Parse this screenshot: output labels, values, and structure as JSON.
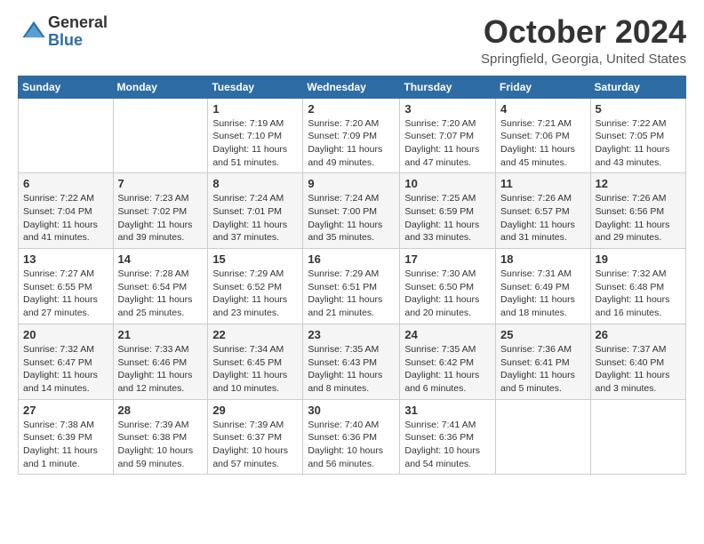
{
  "header": {
    "logo_general": "General",
    "logo_blue": "Blue",
    "month_title": "October 2024",
    "location": "Springfield, Georgia, United States"
  },
  "days_of_week": [
    "Sunday",
    "Monday",
    "Tuesday",
    "Wednesday",
    "Thursday",
    "Friday",
    "Saturday"
  ],
  "weeks": [
    [
      {
        "day": "",
        "info": ""
      },
      {
        "day": "",
        "info": ""
      },
      {
        "day": "1",
        "info": "Sunrise: 7:19 AM\nSunset: 7:10 PM\nDaylight: 11 hours and 51 minutes."
      },
      {
        "day": "2",
        "info": "Sunrise: 7:20 AM\nSunset: 7:09 PM\nDaylight: 11 hours and 49 minutes."
      },
      {
        "day": "3",
        "info": "Sunrise: 7:20 AM\nSunset: 7:07 PM\nDaylight: 11 hours and 47 minutes."
      },
      {
        "day": "4",
        "info": "Sunrise: 7:21 AM\nSunset: 7:06 PM\nDaylight: 11 hours and 45 minutes."
      },
      {
        "day": "5",
        "info": "Sunrise: 7:22 AM\nSunset: 7:05 PM\nDaylight: 11 hours and 43 minutes."
      }
    ],
    [
      {
        "day": "6",
        "info": "Sunrise: 7:22 AM\nSunset: 7:04 PM\nDaylight: 11 hours and 41 minutes."
      },
      {
        "day": "7",
        "info": "Sunrise: 7:23 AM\nSunset: 7:02 PM\nDaylight: 11 hours and 39 minutes."
      },
      {
        "day": "8",
        "info": "Sunrise: 7:24 AM\nSunset: 7:01 PM\nDaylight: 11 hours and 37 minutes."
      },
      {
        "day": "9",
        "info": "Sunrise: 7:24 AM\nSunset: 7:00 PM\nDaylight: 11 hours and 35 minutes."
      },
      {
        "day": "10",
        "info": "Sunrise: 7:25 AM\nSunset: 6:59 PM\nDaylight: 11 hours and 33 minutes."
      },
      {
        "day": "11",
        "info": "Sunrise: 7:26 AM\nSunset: 6:57 PM\nDaylight: 11 hours and 31 minutes."
      },
      {
        "day": "12",
        "info": "Sunrise: 7:26 AM\nSunset: 6:56 PM\nDaylight: 11 hours and 29 minutes."
      }
    ],
    [
      {
        "day": "13",
        "info": "Sunrise: 7:27 AM\nSunset: 6:55 PM\nDaylight: 11 hours and 27 minutes."
      },
      {
        "day": "14",
        "info": "Sunrise: 7:28 AM\nSunset: 6:54 PM\nDaylight: 11 hours and 25 minutes."
      },
      {
        "day": "15",
        "info": "Sunrise: 7:29 AM\nSunset: 6:52 PM\nDaylight: 11 hours and 23 minutes."
      },
      {
        "day": "16",
        "info": "Sunrise: 7:29 AM\nSunset: 6:51 PM\nDaylight: 11 hours and 21 minutes."
      },
      {
        "day": "17",
        "info": "Sunrise: 7:30 AM\nSunset: 6:50 PM\nDaylight: 11 hours and 20 minutes."
      },
      {
        "day": "18",
        "info": "Sunrise: 7:31 AM\nSunset: 6:49 PM\nDaylight: 11 hours and 18 minutes."
      },
      {
        "day": "19",
        "info": "Sunrise: 7:32 AM\nSunset: 6:48 PM\nDaylight: 11 hours and 16 minutes."
      }
    ],
    [
      {
        "day": "20",
        "info": "Sunrise: 7:32 AM\nSunset: 6:47 PM\nDaylight: 11 hours and 14 minutes."
      },
      {
        "day": "21",
        "info": "Sunrise: 7:33 AM\nSunset: 6:46 PM\nDaylight: 11 hours and 12 minutes."
      },
      {
        "day": "22",
        "info": "Sunrise: 7:34 AM\nSunset: 6:45 PM\nDaylight: 11 hours and 10 minutes."
      },
      {
        "day": "23",
        "info": "Sunrise: 7:35 AM\nSunset: 6:43 PM\nDaylight: 11 hours and 8 minutes."
      },
      {
        "day": "24",
        "info": "Sunrise: 7:35 AM\nSunset: 6:42 PM\nDaylight: 11 hours and 6 minutes."
      },
      {
        "day": "25",
        "info": "Sunrise: 7:36 AM\nSunset: 6:41 PM\nDaylight: 11 hours and 5 minutes."
      },
      {
        "day": "26",
        "info": "Sunrise: 7:37 AM\nSunset: 6:40 PM\nDaylight: 11 hours and 3 minutes."
      }
    ],
    [
      {
        "day": "27",
        "info": "Sunrise: 7:38 AM\nSunset: 6:39 PM\nDaylight: 11 hours and 1 minute."
      },
      {
        "day": "28",
        "info": "Sunrise: 7:39 AM\nSunset: 6:38 PM\nDaylight: 10 hours and 59 minutes."
      },
      {
        "day": "29",
        "info": "Sunrise: 7:39 AM\nSunset: 6:37 PM\nDaylight: 10 hours and 57 minutes."
      },
      {
        "day": "30",
        "info": "Sunrise: 7:40 AM\nSunset: 6:36 PM\nDaylight: 10 hours and 56 minutes."
      },
      {
        "day": "31",
        "info": "Sunrise: 7:41 AM\nSunset: 6:36 PM\nDaylight: 10 hours and 54 minutes."
      },
      {
        "day": "",
        "info": ""
      },
      {
        "day": "",
        "info": ""
      }
    ]
  ]
}
